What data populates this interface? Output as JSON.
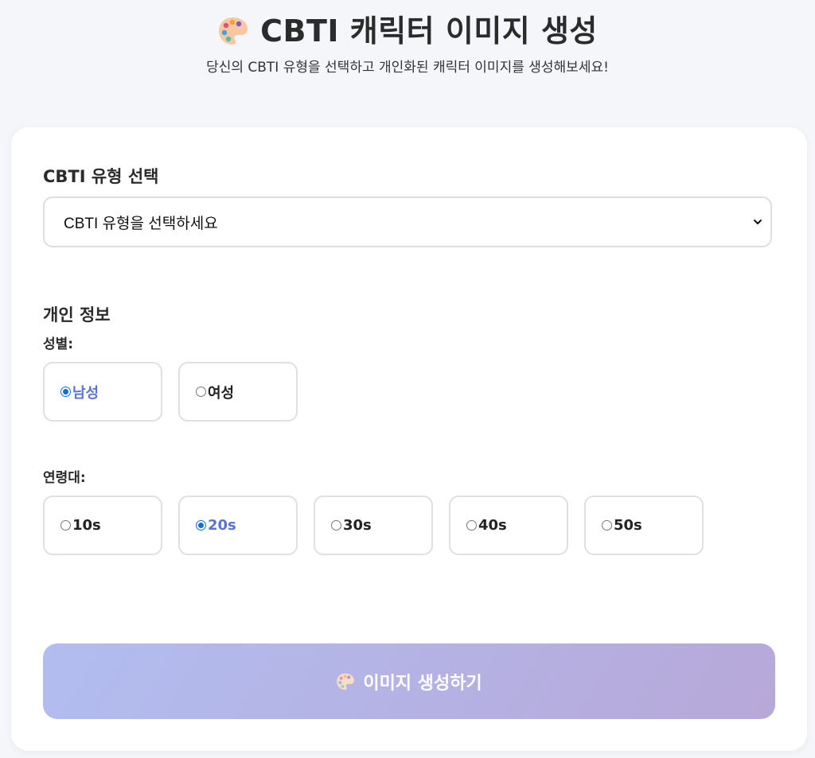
{
  "header": {
    "title": "CBTI 캐릭터 이미지 생성",
    "subtitle": "당신의 CBTI 유형을 선택하고 개인화된 캐릭터 이미지를 생성해보세요!"
  },
  "form": {
    "type_section_title": "CBTI 유형 선택",
    "type_select_value": "CBTI 유형을 선택하세요",
    "personal_section_title": "개인 정보",
    "gender": {
      "label": "성별:",
      "options": [
        "남성",
        "여성"
      ],
      "selected": "남성"
    },
    "age": {
      "label": "연령대:",
      "options": [
        "10s",
        "20s",
        "30s",
        "40s",
        "50s"
      ],
      "selected": "20s"
    },
    "generate_button_label": "이미지 생성하기"
  },
  "icons": {
    "title_icon": "palette-icon",
    "button_icon": "palette-icon"
  },
  "colors": {
    "selected_text": "#5a73d8",
    "button_gradient_start": "#b2bdf0",
    "button_gradient_end": "#b7a8d8"
  }
}
